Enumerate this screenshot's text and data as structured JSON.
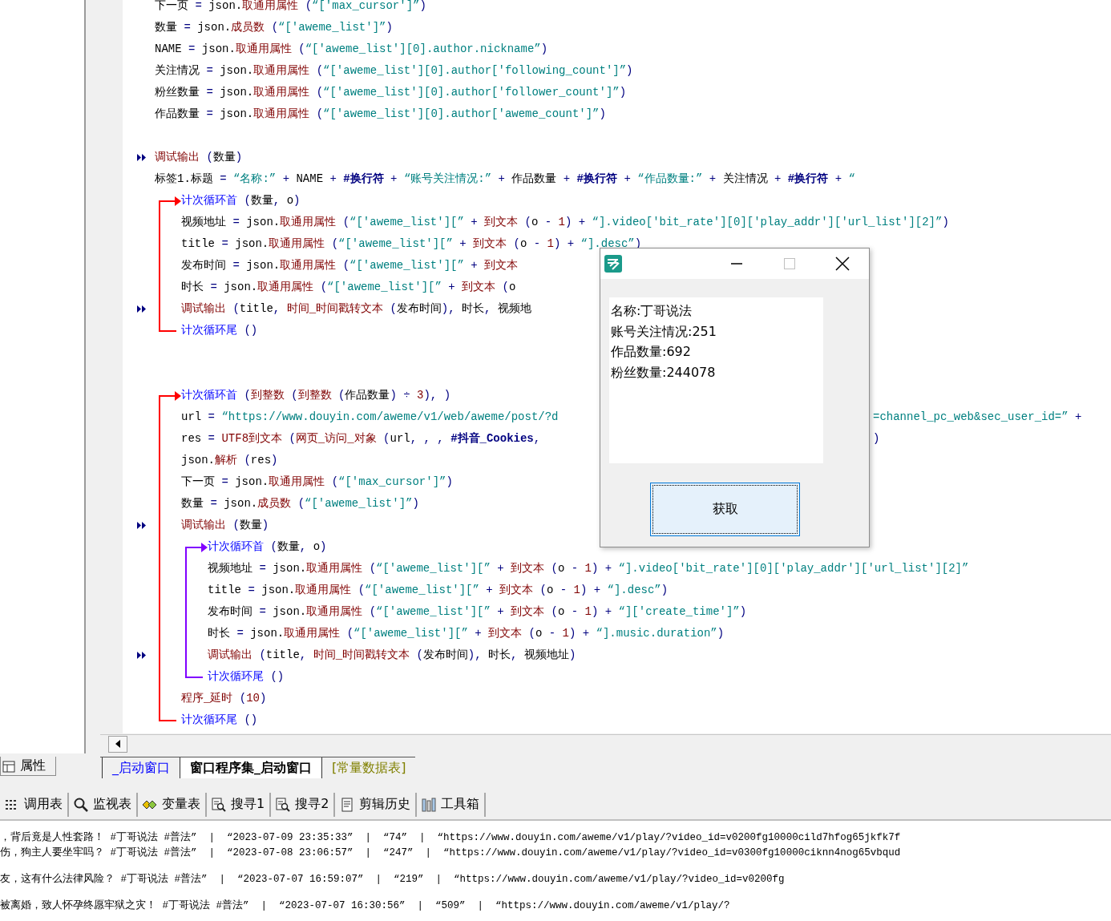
{
  "code": [
    {
      "kind": "line",
      "tokens": [
        {
          "kind": "var",
          "text": "下一页"
        },
        {
          "kind": "op",
          "text": " = "
        },
        {
          "kind": "var",
          "text": "json."
        },
        {
          "kind": "call",
          "text": "取通用属性"
        },
        {
          "kind": "op",
          "text": " ("
        },
        {
          "kind": "str",
          "text": "“['max_cursor']”"
        },
        {
          "kind": "op",
          "text": ")"
        }
      ]
    },
    {
      "kind": "line",
      "tokens": [
        {
          "kind": "var",
          "text": "数量"
        },
        {
          "kind": "op",
          "text": " = "
        },
        {
          "kind": "var",
          "text": "json."
        },
        {
          "kind": "call",
          "text": "成员数"
        },
        {
          "kind": "op",
          "text": " ("
        },
        {
          "kind": "str",
          "text": "“['aweme_list']”"
        },
        {
          "kind": "op",
          "text": ")"
        }
      ]
    },
    {
      "kind": "line",
      "tokens": [
        {
          "kind": "var",
          "text": "NAME"
        },
        {
          "kind": "op",
          "text": " = "
        },
        {
          "kind": "var",
          "text": "json."
        },
        {
          "kind": "call",
          "text": "取通用属性"
        },
        {
          "kind": "op",
          "text": " ("
        },
        {
          "kind": "str",
          "text": "“['aweme_list'][0].author.nickname”"
        },
        {
          "kind": "op",
          "text": ")"
        }
      ]
    },
    {
      "kind": "line",
      "tokens": [
        {
          "kind": "var",
          "text": "关注情况"
        },
        {
          "kind": "op",
          "text": " = "
        },
        {
          "kind": "var",
          "text": "json."
        },
        {
          "kind": "call",
          "text": "取通用属性"
        },
        {
          "kind": "op",
          "text": " ("
        },
        {
          "kind": "str",
          "text": "“['aweme_list'][0].author['following_count']”"
        },
        {
          "kind": "op",
          "text": ")"
        }
      ]
    },
    {
      "kind": "line",
      "tokens": [
        {
          "kind": "var",
          "text": "粉丝数量"
        },
        {
          "kind": "op",
          "text": " = "
        },
        {
          "kind": "var",
          "text": "json."
        },
        {
          "kind": "call",
          "text": "取通用属性"
        },
        {
          "kind": "op",
          "text": " ("
        },
        {
          "kind": "str",
          "text": "“['aweme_list'][0].author['follower_count']”"
        },
        {
          "kind": "op",
          "text": ")"
        }
      ]
    },
    {
      "kind": "line",
      "tokens": [
        {
          "kind": "var",
          "text": "作品数量"
        },
        {
          "kind": "op",
          "text": " = "
        },
        {
          "kind": "var",
          "text": "json."
        },
        {
          "kind": "call",
          "text": "取通用属性"
        },
        {
          "kind": "op",
          "text": " ("
        },
        {
          "kind": "str",
          "text": "“['aweme_list'][0].author['aweme_count']”"
        },
        {
          "kind": "op",
          "text": ")"
        }
      ]
    },
    {
      "kind": "blank"
    },
    {
      "kind": "marked_line",
      "tokens": [
        {
          "kind": "call",
          "text": "调试输出"
        },
        {
          "kind": "op",
          "text": " ("
        },
        {
          "kind": "var",
          "text": "数量"
        },
        {
          "kind": "op",
          "text": ")"
        }
      ]
    },
    {
      "kind": "line",
      "tokens": [
        {
          "kind": "var",
          "text": "标签1.标题"
        },
        {
          "kind": "op",
          "text": " = "
        },
        {
          "kind": "str",
          "text": "“名称:”"
        },
        {
          "kind": "op",
          "text": " + "
        },
        {
          "kind": "var",
          "text": "NAME"
        },
        {
          "kind": "op",
          "text": " + "
        },
        {
          "kind": "const",
          "text": "#换行符"
        },
        {
          "kind": "op",
          "text": " + "
        },
        {
          "kind": "str",
          "text": "“账号关注情况:”"
        },
        {
          "kind": "op",
          "text": " + "
        },
        {
          "kind": "var",
          "text": "作品数量"
        },
        {
          "kind": "op",
          "text": " + "
        },
        {
          "kind": "const",
          "text": "#换行符"
        },
        {
          "kind": "op",
          "text": " + "
        },
        {
          "kind": "str",
          "text": "“作品数量:”"
        },
        {
          "kind": "op",
          "text": " + "
        },
        {
          "kind": "var",
          "text": "关注情况"
        },
        {
          "kind": "op",
          "text": " + "
        },
        {
          "kind": "const",
          "text": "#换行符"
        },
        {
          "kind": "op",
          "text": " + "
        },
        {
          "kind": "str",
          "text": "“"
        }
      ]
    },
    {
      "kind": "loop",
      "color": "#ff0000",
      "head": [
        {
          "kind": "flow",
          "text": "计次循环首"
        },
        {
          "kind": "op",
          "text": " ("
        },
        {
          "kind": "var",
          "text": "数量"
        },
        {
          "kind": "op",
          "text": ", "
        },
        {
          "kind": "var",
          "text": "o"
        },
        {
          "kind": "op",
          "text": ")"
        }
      ],
      "children": [
        {
          "kind": "line",
          "tokens": [
            {
              "kind": "var",
              "text": "视频地址"
            },
            {
              "kind": "op",
              "text": " = "
            },
            {
              "kind": "var",
              "text": "json."
            },
            {
              "kind": "call",
              "text": "取通用属性"
            },
            {
              "kind": "op",
              "text": " ("
            },
            {
              "kind": "str",
              "text": "“['aweme_list'][”"
            },
            {
              "kind": "op",
              "text": " + "
            },
            {
              "kind": "call",
              "text": "到文本"
            },
            {
              "kind": "op",
              "text": " ("
            },
            {
              "kind": "var",
              "text": "o"
            },
            {
              "kind": "op",
              "text": " - "
            },
            {
              "kind": "num",
              "text": "1"
            },
            {
              "kind": "op",
              "text": ") + "
            },
            {
              "kind": "str",
              "text": "“].video['bit_rate'][0]['play_addr']['url_list'][2]”"
            },
            {
              "kind": "op",
              "text": ")"
            }
          ]
        },
        {
          "kind": "line",
          "tokens": [
            {
              "kind": "var",
              "text": "title"
            },
            {
              "kind": "op",
              "text": " = "
            },
            {
              "kind": "var",
              "text": "json."
            },
            {
              "kind": "call",
              "text": "取通用属性"
            },
            {
              "kind": "op",
              "text": " ("
            },
            {
              "kind": "str",
              "text": "“['aweme_list'][”"
            },
            {
              "kind": "op",
              "text": " + "
            },
            {
              "kind": "call",
              "text": "到文本"
            },
            {
              "kind": "op",
              "text": " ("
            },
            {
              "kind": "var",
              "text": "o"
            },
            {
              "kind": "op",
              "text": " - "
            },
            {
              "kind": "num",
              "text": "1"
            },
            {
              "kind": "op",
              "text": ") + "
            },
            {
              "kind": "str",
              "text": "“].desc”"
            },
            {
              "kind": "op",
              "text": ")"
            }
          ]
        },
        {
          "kind": "line",
          "tokens": [
            {
              "kind": "var",
              "text": "发布时间"
            },
            {
              "kind": "op",
              "text": " = "
            },
            {
              "kind": "var",
              "text": "json."
            },
            {
              "kind": "call",
              "text": "取通用属性"
            },
            {
              "kind": "op",
              "text": " ("
            },
            {
              "kind": "str",
              "text": "“['aweme_list'][”"
            },
            {
              "kind": "op",
              "text": " + "
            },
            {
              "kind": "call",
              "text": "到文本"
            }
          ]
        },
        {
          "kind": "line",
          "tokens": [
            {
              "kind": "var",
              "text": "时长"
            },
            {
              "kind": "op",
              "text": " = "
            },
            {
              "kind": "var",
              "text": "json."
            },
            {
              "kind": "call",
              "text": "取通用属性"
            },
            {
              "kind": "op",
              "text": " ("
            },
            {
              "kind": "str",
              "text": "“['aweme_list'][”"
            },
            {
              "kind": "op",
              "text": " + "
            },
            {
              "kind": "call",
              "text": "到文本"
            },
            {
              "kind": "op",
              "text": " ("
            },
            {
              "kind": "var",
              "text": "o"
            }
          ]
        },
        {
          "kind": "marked_line",
          "tokens": [
            {
              "kind": "call",
              "text": "调试输出"
            },
            {
              "kind": "op",
              "text": " ("
            },
            {
              "kind": "var",
              "text": "title"
            },
            {
              "kind": "op",
              "text": ", "
            },
            {
              "kind": "call",
              "text": "时间_时间戳转文本"
            },
            {
              "kind": "op",
              "text": " ("
            },
            {
              "kind": "var",
              "text": "发布时间"
            },
            {
              "kind": "op",
              "text": "), "
            },
            {
              "kind": "var",
              "text": "时长"
            },
            {
              "kind": "op",
              "text": ", "
            },
            {
              "kind": "var",
              "text": "视频地"
            }
          ]
        }
      ],
      "tail": [
        {
          "kind": "flow",
          "text": "计次循环尾"
        },
        {
          "kind": "op",
          "text": " ()"
        }
      ]
    },
    {
      "kind": "blank"
    },
    {
      "kind": "blank"
    },
    {
      "kind": "loop",
      "color": "#ff0000",
      "head": [
        {
          "kind": "flow",
          "text": "计次循环首"
        },
        {
          "kind": "op",
          "text": " ("
        },
        {
          "kind": "call",
          "text": "到整数"
        },
        {
          "kind": "op",
          "text": " ("
        },
        {
          "kind": "call",
          "text": "到整数"
        },
        {
          "kind": "op",
          "text": " ("
        },
        {
          "kind": "var",
          "text": "作品数量"
        },
        {
          "kind": "op",
          "text": ") ÷ "
        },
        {
          "kind": "num",
          "text": "3"
        },
        {
          "kind": "op",
          "text": "), )"
        }
      ],
      "children": [
        {
          "kind": "line",
          "tokens": [
            {
              "kind": "var",
              "text": "url"
            },
            {
              "kind": "op",
              "text": " = "
            },
            {
              "kind": "str",
              "text": "“https://www.douyin.com/aweme/v1/web/aweme/post/?d"
            }
          ],
          "after": [
            {
              "kind": "str",
              "text": "=channel_pc_web&sec_user_id=”"
            },
            {
              "kind": "op",
              "text": " +"
            }
          ]
        },
        {
          "kind": "line",
          "tokens": [
            {
              "kind": "var",
              "text": "res"
            },
            {
              "kind": "op",
              "text": " = "
            },
            {
              "kind": "call",
              "text": "UTF8到文本"
            },
            {
              "kind": "op",
              "text": " ("
            },
            {
              "kind": "call",
              "text": "网页_访问_对象"
            },
            {
              "kind": "op",
              "text": " ("
            },
            {
              "kind": "var",
              "text": "url"
            },
            {
              "kind": "op",
              "text": ", , , "
            },
            {
              "kind": "const",
              "text": "#抖音_Cookies"
            },
            {
              "kind": "op",
              "text": ","
            }
          ],
          "after": [
            {
              "kind": "op",
              "text": ")"
            }
          ]
        },
        {
          "kind": "line",
          "tokens": [
            {
              "kind": "var",
              "text": "json."
            },
            {
              "kind": "call",
              "text": "解析"
            },
            {
              "kind": "op",
              "text": " ("
            },
            {
              "kind": "var",
              "text": "res"
            },
            {
              "kind": "op",
              "text": ")"
            }
          ]
        },
        {
          "kind": "line",
          "tokens": [
            {
              "kind": "var",
              "text": "下一页"
            },
            {
              "kind": "op",
              "text": " = "
            },
            {
              "kind": "var",
              "text": "json."
            },
            {
              "kind": "call",
              "text": "取通用属性"
            },
            {
              "kind": "op",
              "text": " ("
            },
            {
              "kind": "str",
              "text": "“['max_cursor']”"
            },
            {
              "kind": "op",
              "text": ")"
            }
          ]
        },
        {
          "kind": "line",
          "tokens": [
            {
              "kind": "var",
              "text": "数量"
            },
            {
              "kind": "op",
              "text": " = "
            },
            {
              "kind": "var",
              "text": "json."
            },
            {
              "kind": "call",
              "text": "成员数"
            },
            {
              "kind": "op",
              "text": " ("
            },
            {
              "kind": "str",
              "text": "“['aweme_list']”"
            },
            {
              "kind": "op",
              "text": ")"
            }
          ]
        },
        {
          "kind": "marked_line",
          "tokens": [
            {
              "kind": "call",
              "text": "调试输出"
            },
            {
              "kind": "op",
              "text": " ("
            },
            {
              "kind": "var",
              "text": "数量"
            },
            {
              "kind": "op",
              "text": ")"
            }
          ]
        },
        {
          "kind": "loop",
          "color": "#8000ff",
          "head": [
            {
              "kind": "flow",
              "text": "计次循环首"
            },
            {
              "kind": "op",
              "text": " ("
            },
            {
              "kind": "var",
              "text": "数量"
            },
            {
              "kind": "op",
              "text": ", "
            },
            {
              "kind": "var",
              "text": "o"
            },
            {
              "kind": "op",
              "text": ")"
            }
          ],
          "children": [
            {
              "kind": "line",
              "tokens": [
                {
                  "kind": "var",
                  "text": "视频地址"
                },
                {
                  "kind": "op",
                  "text": " = "
                },
                {
                  "kind": "var",
                  "text": "json."
                },
                {
                  "kind": "call",
                  "text": "取通用属性"
                },
                {
                  "kind": "op",
                  "text": " ("
                },
                {
                  "kind": "str",
                  "text": "“['aweme_list'][”"
                },
                {
                  "kind": "op",
                  "text": " + "
                },
                {
                  "kind": "call",
                  "text": "到文本"
                },
                {
                  "kind": "op",
                  "text": " ("
                },
                {
                  "kind": "var",
                  "text": "o"
                },
                {
                  "kind": "op",
                  "text": " - "
                },
                {
                  "kind": "num",
                  "text": "1"
                },
                {
                  "kind": "op",
                  "text": ") + "
                },
                {
                  "kind": "str",
                  "text": "“].video['bit_rate'][0]['play_addr']['url_list'][2]”"
                }
              ]
            },
            {
              "kind": "line",
              "tokens": [
                {
                  "kind": "var",
                  "text": "title"
                },
                {
                  "kind": "op",
                  "text": " = "
                },
                {
                  "kind": "var",
                  "text": "json."
                },
                {
                  "kind": "call",
                  "text": "取通用属性"
                },
                {
                  "kind": "op",
                  "text": " ("
                },
                {
                  "kind": "str",
                  "text": "“['aweme_list'][”"
                },
                {
                  "kind": "op",
                  "text": " + "
                },
                {
                  "kind": "call",
                  "text": "到文本"
                },
                {
                  "kind": "op",
                  "text": " ("
                },
                {
                  "kind": "var",
                  "text": "o"
                },
                {
                  "kind": "op",
                  "text": " - "
                },
                {
                  "kind": "num",
                  "text": "1"
                },
                {
                  "kind": "op",
                  "text": ") + "
                },
                {
                  "kind": "str",
                  "text": "“].desc”"
                },
                {
                  "kind": "op",
                  "text": ")"
                }
              ]
            },
            {
              "kind": "line",
              "tokens": [
                {
                  "kind": "var",
                  "text": "发布时间"
                },
                {
                  "kind": "op",
                  "text": " = "
                },
                {
                  "kind": "var",
                  "text": "json."
                },
                {
                  "kind": "call",
                  "text": "取通用属性"
                },
                {
                  "kind": "op",
                  "text": " ("
                },
                {
                  "kind": "str",
                  "text": "“['aweme_list'][”"
                },
                {
                  "kind": "op",
                  "text": " + "
                },
                {
                  "kind": "call",
                  "text": "到文本"
                },
                {
                  "kind": "op",
                  "text": " ("
                },
                {
                  "kind": "var",
                  "text": "o"
                },
                {
                  "kind": "op",
                  "text": " - "
                },
                {
                  "kind": "num",
                  "text": "1"
                },
                {
                  "kind": "op",
                  "text": ") + "
                },
                {
                  "kind": "str",
                  "text": "“]['create_time']”"
                },
                {
                  "kind": "op",
                  "text": ")"
                }
              ]
            },
            {
              "kind": "line",
              "tokens": [
                {
                  "kind": "var",
                  "text": "时长"
                },
                {
                  "kind": "op",
                  "text": " = "
                },
                {
                  "kind": "var",
                  "text": "json."
                },
                {
                  "kind": "call",
                  "text": "取通用属性"
                },
                {
                  "kind": "op",
                  "text": " ("
                },
                {
                  "kind": "str",
                  "text": "“['aweme_list'][”"
                },
                {
                  "kind": "op",
                  "text": " + "
                },
                {
                  "kind": "call",
                  "text": "到文本"
                },
                {
                  "kind": "op",
                  "text": " ("
                },
                {
                  "kind": "var",
                  "text": "o"
                },
                {
                  "kind": "op",
                  "text": " - "
                },
                {
                  "kind": "num",
                  "text": "1"
                },
                {
                  "kind": "op",
                  "text": ") + "
                },
                {
                  "kind": "str",
                  "text": "“].music.duration”"
                },
                {
                  "kind": "op",
                  "text": ")"
                }
              ]
            },
            {
              "kind": "marked_line",
              "tokens": [
                {
                  "kind": "call",
                  "text": "调试输出"
                },
                {
                  "kind": "op",
                  "text": " ("
                },
                {
                  "kind": "var",
                  "text": "title"
                },
                {
                  "kind": "op",
                  "text": ", "
                },
                {
                  "kind": "call",
                  "text": "时间_时间戳转文本"
                },
                {
                  "kind": "op",
                  "text": " ("
                },
                {
                  "kind": "var",
                  "text": "发布时间"
                },
                {
                  "kind": "op",
                  "text": "), "
                },
                {
                  "kind": "var",
                  "text": "时长"
                },
                {
                  "kind": "op",
                  "text": ", "
                },
                {
                  "kind": "var",
                  "text": "视频地址"
                },
                {
                  "kind": "op",
                  "text": ")"
                }
              ]
            }
          ],
          "tail": [
            {
              "kind": "flow",
              "text": "计次循环尾"
            },
            {
              "kind": "op",
              "text": " ()"
            }
          ]
        },
        {
          "kind": "line",
          "tokens": [
            {
              "kind": "call",
              "text": "程序_延时"
            },
            {
              "kind": "op",
              "text": " ("
            },
            {
              "kind": "num",
              "text": "10"
            },
            {
              "kind": "op",
              "text": ")"
            }
          ]
        }
      ],
      "tail": [
        {
          "kind": "flow",
          "text": "计次循环尾"
        },
        {
          "kind": "op",
          "text": " ()"
        }
      ]
    }
  ],
  "dialog": {
    "lines": [
      "名称:丁哥说法",
      "账号关注情况:251",
      "作品数量:692",
      "粉丝数量:244078"
    ],
    "button": "获取"
  },
  "property_tab": "属性",
  "editor_tabs": [
    {
      "label": "_启动窗口",
      "kind": "window",
      "selected": false
    },
    {
      "label": "窗口程序集_启动窗口",
      "kind": "module",
      "selected": true
    },
    {
      "label": "[常量数据表]",
      "kind": "constants",
      "selected": false
    }
  ],
  "toolbar": [
    {
      "label": "调用表",
      "kind": "calls"
    },
    {
      "label": "监视表",
      "kind": "watch"
    },
    {
      "label": "变量表",
      "kind": "vars"
    },
    {
      "label": "搜寻1",
      "kind": "find"
    },
    {
      "label": "搜寻2",
      "kind": "find"
    },
    {
      "label": "剪辑历史",
      "kind": "clip"
    },
    {
      "label": "工具箱",
      "kind": "tools"
    }
  ],
  "output": [
    "，背后竟是人性套路！ #丁哥说法 #普法”  |  “2023-07-09 23:35:33”  |  “74”  |  “https://www.douyin.com/aweme/v1/play/?video_id=v0200fg10000cild7hfog65jkfk7f",
    "伤，狗主人要坐牢吗？ #丁哥说法 #普法”  |  “2023-07-08 23:06:57”  |  “247”  |  “https://www.douyin.com/aweme/v1/play/?video_id=v0300fg10000ciknn4nog65vbqud",
    "友，这有什么法律风险？ #丁哥说法 #普法”  |  “2023-07-07 16:59:07”  |  “219”  |  “https://www.douyin.com/aweme/v1/play/?video_id=v0200fg",
    "被离婚，致人怀孕终愿牢狱之灾！ #丁哥说法 #普法”  |  “2023-07-07 16:30:56”  |  “509”  |  “https://www.douyin.com/aweme/v1/play/?"
  ]
}
